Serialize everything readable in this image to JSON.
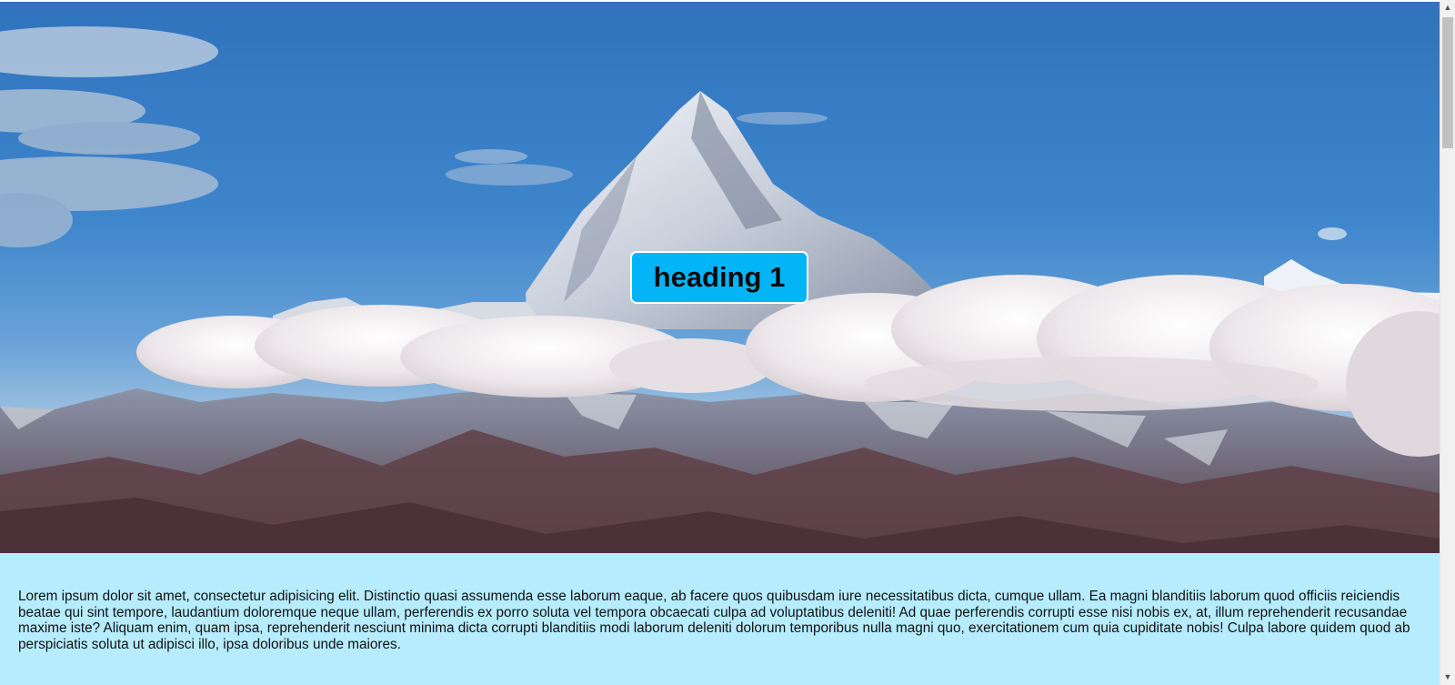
{
  "hero": {
    "heading": "heading 1",
    "heading_bg_color": "#03b5f7",
    "image": "mountain-peak-above-clouds"
  },
  "content": {
    "paragraph": "Lorem ipsum dolor sit amet, consectetur adipisicing elit. Distinctio quasi assumenda esse laborum eaque, ab facere quos quibusdam iure necessitatibus dicta, cumque ullam. Ea magni blanditiis laborum quod officiis reiciendis beatae qui sint tempore, laudantium doloremque neque ullam, perferendis ex porro soluta vel tempora obcaecati culpa ad voluptatibus deleniti! Ad quae perferendis corrupti esse nisi nobis ex, at, illum reprehenderit recusandae maxime iste? Aliquam enim, quam ipsa, reprehenderit nesciunt minima dicta corrupti blanditiis modi laborum deleniti dolorum temporibus nulla magni quo, exercitationem cum quia cupiditate nobis! Culpa labore quidem quod ab perspiciatis soluta ut adipisci illo, ipsa doloribus unde maiores.",
    "bg_color": "#b6ecfe"
  },
  "scrollbar": {
    "up_icon": "scroll-up-arrow",
    "down_icon": "scroll-down-arrow",
    "up_glyph": "▲",
    "down_glyph": "▼"
  }
}
